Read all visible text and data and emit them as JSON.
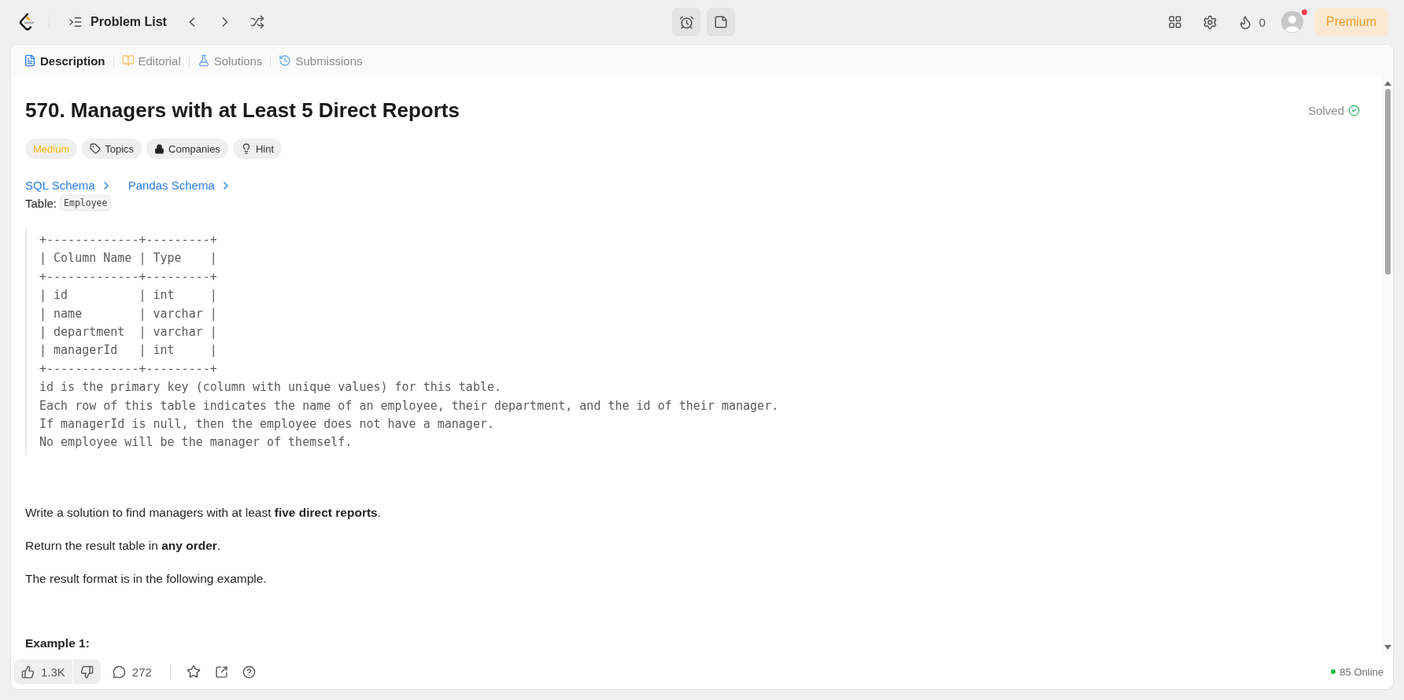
{
  "toolbar": {
    "problem_list": "Problem List",
    "streak_count": "0",
    "premium": "Premium",
    "avatar_notification": true
  },
  "tabs": [
    {
      "label": "Description",
      "selected": true
    },
    {
      "label": "Editorial",
      "selected": false
    },
    {
      "label": "Solutions",
      "selected": false
    },
    {
      "label": "Submissions",
      "selected": false
    }
  ],
  "problem": {
    "title": "570. Managers with at Least 5 Direct Reports",
    "status": "Solved",
    "difficulty": "Medium",
    "tags": [
      "Topics",
      "Companies",
      "Hint"
    ],
    "schema_links": [
      "SQL Schema",
      "Pandas Schema"
    ],
    "table_label": "Table:",
    "table_name": "Employee",
    "code_lines": [
      "+-------------+---------+",
      "| Column Name | Type    |",
      "+-------------+---------+",
      "| id          | int     |",
      "| name        | varchar |",
      "| department  | varchar |",
      "| managerId   | int     |",
      "+-------------+---------+",
      "id is the primary key (column with unique values) for this table.",
      "Each row of this table indicates the name of an employee, their department, and the id of their manager.",
      "If managerId is null, then the employee does not have a manager.",
      "No employee will be the manager of themself."
    ],
    "paragraphs": [
      "Write a solution to find managers with at least **five direct reports**.",
      "Return the result table in **any order**.",
      "The result format is in the following example."
    ],
    "example_heading": "Example 1:"
  },
  "footer": {
    "likes": "1.3K",
    "comments": "272",
    "online": "85 Online"
  }
}
